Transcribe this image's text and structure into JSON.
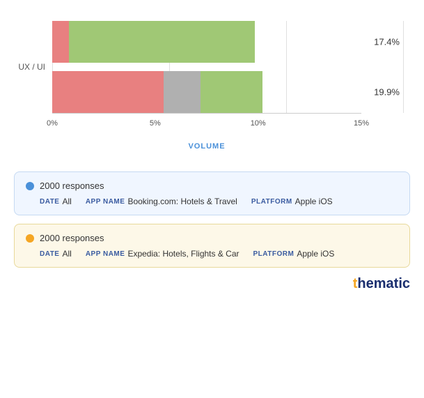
{
  "chart": {
    "y_label": "UX / UI",
    "x_axis_label": "VOLUME",
    "x_ticks": [
      "0%",
      "5%",
      "10%",
      "15%"
    ],
    "x_tick_positions": [
      0,
      33.3,
      66.6,
      100
    ],
    "bars": [
      {
        "id": "bar1",
        "label": "17.4%",
        "segments": [
          {
            "color": "#e88080",
            "width_pct": 5.5,
            "label": "pink"
          },
          {
            "color": "#a0c875",
            "width_pct": 60,
            "label": "green"
          }
        ]
      },
      {
        "id": "bar2",
        "label": "19.9%",
        "segments": [
          {
            "color": "#e88080",
            "width_pct": 36,
            "label": "pink"
          },
          {
            "color": "#b0b0b0",
            "width_pct": 12,
            "label": "gray"
          },
          {
            "color": "#a0c875",
            "width_pct": 20,
            "label": "green"
          }
        ]
      }
    ]
  },
  "legends": [
    {
      "id": "legend1",
      "dot_color": "#4a90d9",
      "responses": "2000 responses",
      "date_label": "DATE",
      "date_value": "All",
      "app_label": "APP NAME",
      "app_value": "Booking.com: Hotels & Travel",
      "platform_label": "PLATFORM",
      "platform_value": "Apple iOS",
      "card_class": "blue-card"
    },
    {
      "id": "legend2",
      "dot_color": "#f5a623",
      "responses": "2000 responses",
      "date_label": "DATE",
      "date_value": "All",
      "app_label": "APP NAME",
      "app_value": "Expedia: Hotels, Flights & Car",
      "platform_label": "PLATFORM",
      "platform_value": "Apple iOS",
      "card_class": "yellow-card"
    }
  ],
  "branding": {
    "text": "thematic",
    "highlight": "t"
  }
}
